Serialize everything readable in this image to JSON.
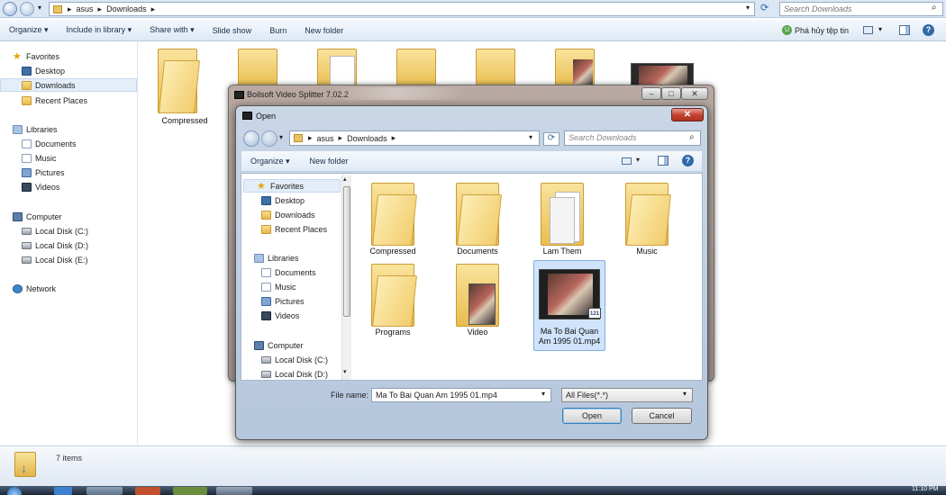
{
  "explorer": {
    "address": {
      "crumbs": [
        "asus",
        "Downloads"
      ]
    },
    "search_placeholder": "Search Downloads",
    "toolbar": {
      "organize": "Organize ▾",
      "include_in_library": "Include in library ▾",
      "share_with": "Share with ▾",
      "slide_show": "Slide show",
      "burn": "Burn",
      "new_folder": "New folder",
      "extra": "Phá hủy tệp tin"
    },
    "sidebar": {
      "favorites": "Favorites",
      "desktop": "Desktop",
      "downloads": "Downloads",
      "recent_places": "Recent Places",
      "libraries": "Libraries",
      "documents": "Documents",
      "music": "Music",
      "pictures": "Pictures",
      "videos": "Videos",
      "computer": "Computer",
      "disk_c": "Local Disk (C:)",
      "disk_d": "Local Disk (D:)",
      "disk_e": "Local Disk (E:)",
      "network": "Network"
    },
    "files": {
      "compressed": "Compressed"
    },
    "status": {
      "items": "7 items"
    },
    "clock": "11:10 PM"
  },
  "boilsoft": {
    "title": "Boilsoft Video Splitter 7.02.2"
  },
  "open_dialog": {
    "title": "Open",
    "address": {
      "crumbs": [
        "asus",
        "Downloads"
      ]
    },
    "search_placeholder": "Search Downloads",
    "toolbar": {
      "organize": "Organize ▾",
      "new_folder": "New folder"
    },
    "nav": {
      "favorites": "Favorites",
      "desktop": "Desktop",
      "downloads": "Downloads",
      "recent_places": "Recent Places",
      "libraries": "Libraries",
      "documents": "Documents",
      "music": "Music",
      "pictures": "Pictures",
      "videos": "Videos",
      "computer": "Computer",
      "disk_c": "Local Disk (C:)",
      "disk_d": "Local Disk (D:)"
    },
    "files": {
      "compressed": "Compressed",
      "documents": "Documents",
      "lam_them": "Lam Them",
      "music": "Music",
      "programs": "Programs",
      "video": "Video",
      "mp4_line1": "Ma To Bai Quan",
      "mp4_line2": "Am 1995 01.mp4"
    },
    "filename_label": "File name:",
    "filename_value": "Ma To Bai Quan Am 1995 01.mp4",
    "filetype_value": "All Files(*.*)",
    "open_button": "Open",
    "cancel_button": "Cancel"
  }
}
